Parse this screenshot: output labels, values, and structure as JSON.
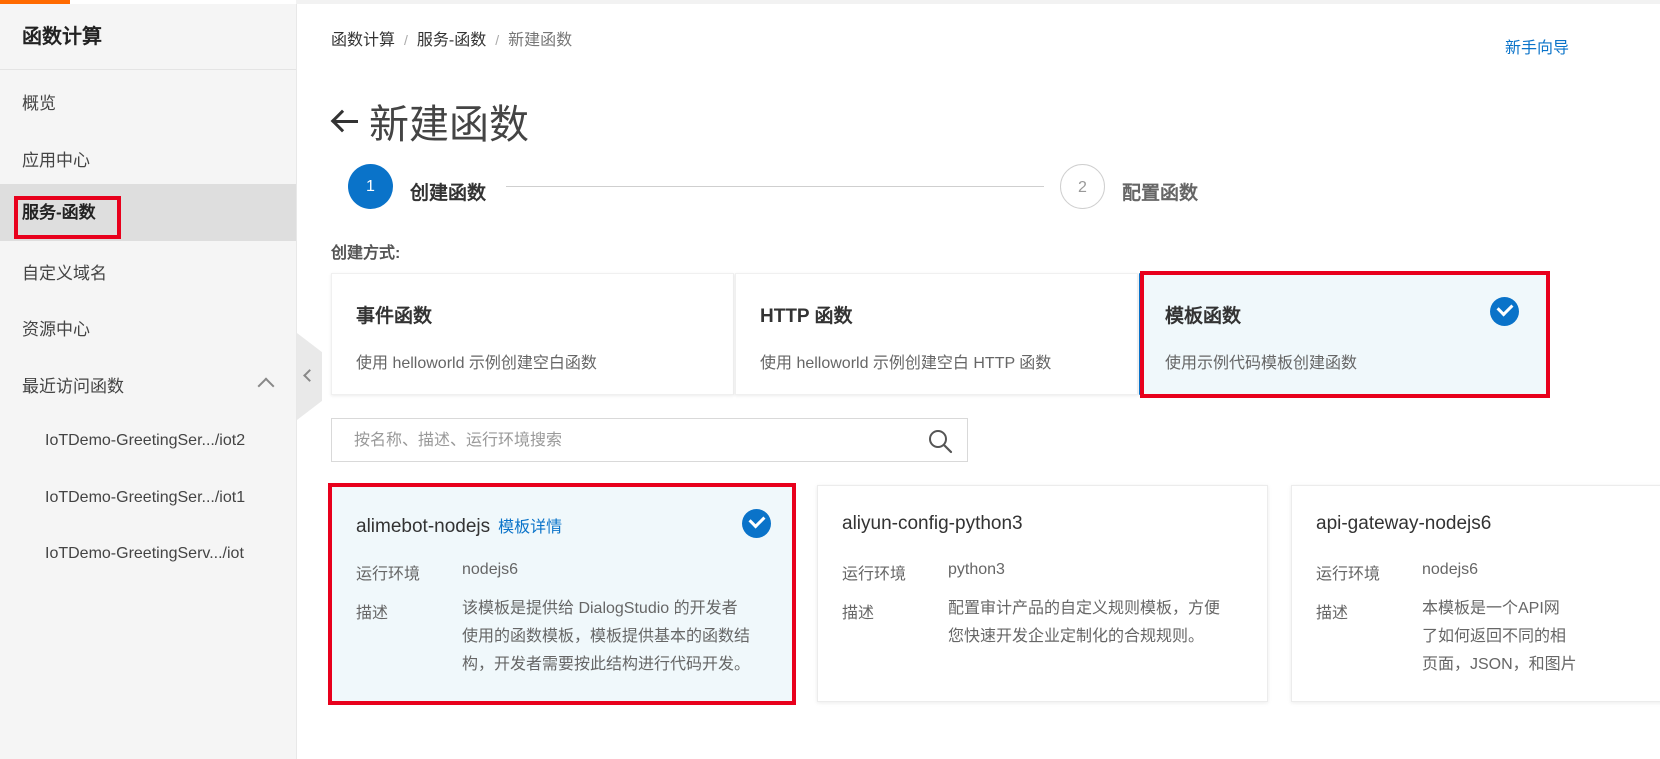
{
  "sidebar": {
    "title": "函数计算",
    "items": [
      {
        "label": "概览"
      },
      {
        "label": "应用中心"
      },
      {
        "label": "服务-函数"
      },
      {
        "label": "自定义域名"
      },
      {
        "label": "资源中心"
      },
      {
        "label": "最近访问函数"
      }
    ],
    "recent": [
      {
        "label": "IoTDemo-GreetingSer.../iot2"
      },
      {
        "label": "IoTDemo-GreetingSer.../iot1"
      },
      {
        "label": "IoTDemo-GreetingServ.../iot"
      }
    ]
  },
  "breadcrumb": {
    "items": [
      "函数计算",
      "服务-函数",
      "新建函数"
    ],
    "sep": "/"
  },
  "guide_link": "新手向导",
  "page_title": "新建函数",
  "steps": [
    {
      "num": "1",
      "label": "创建函数"
    },
    {
      "num": "2",
      "label": "配置函数"
    }
  ],
  "create_mode_label": "创建方式:",
  "function_types": [
    {
      "title": "事件函数",
      "desc": "使用 helloworld 示例创建空白函数"
    },
    {
      "title": "HTTP 函数",
      "desc": "使用 helloworld 示例创建空白 HTTP 函数"
    },
    {
      "title": "模板函数",
      "desc": "使用示例代码模板创建函数"
    }
  ],
  "search": {
    "placeholder": "按名称、描述、运行环境搜索",
    "value": ""
  },
  "template_labels": {
    "runtime": "运行环境",
    "desc": "描述",
    "detail_link": "模板详情"
  },
  "templates": [
    {
      "name": "alimebot-nodejs",
      "runtime": "nodejs6",
      "desc_lines": [
        "该模板是提供给 DialogStudio 的开发者",
        "使用的函数模板，模板提供基本的函数结",
        "构，开发者需要按此结构进行代码开发。"
      ]
    },
    {
      "name": "aliyun-config-python3",
      "runtime": "python3",
      "desc_lines": [
        "配置审计产品的自定义规则模板，方便",
        "您快速开发企业定制化的合规规则。"
      ]
    },
    {
      "name": "api-gateway-nodejs6",
      "runtime": "nodejs6",
      "desc_lines": [
        "本模板是一个API网",
        "了如何返回不同的相",
        "页面，JSON，和图片"
      ]
    }
  ],
  "colors": {
    "accent": "#0a73c9",
    "highlight": "#e8001c",
    "brand": "#ff6a00"
  }
}
